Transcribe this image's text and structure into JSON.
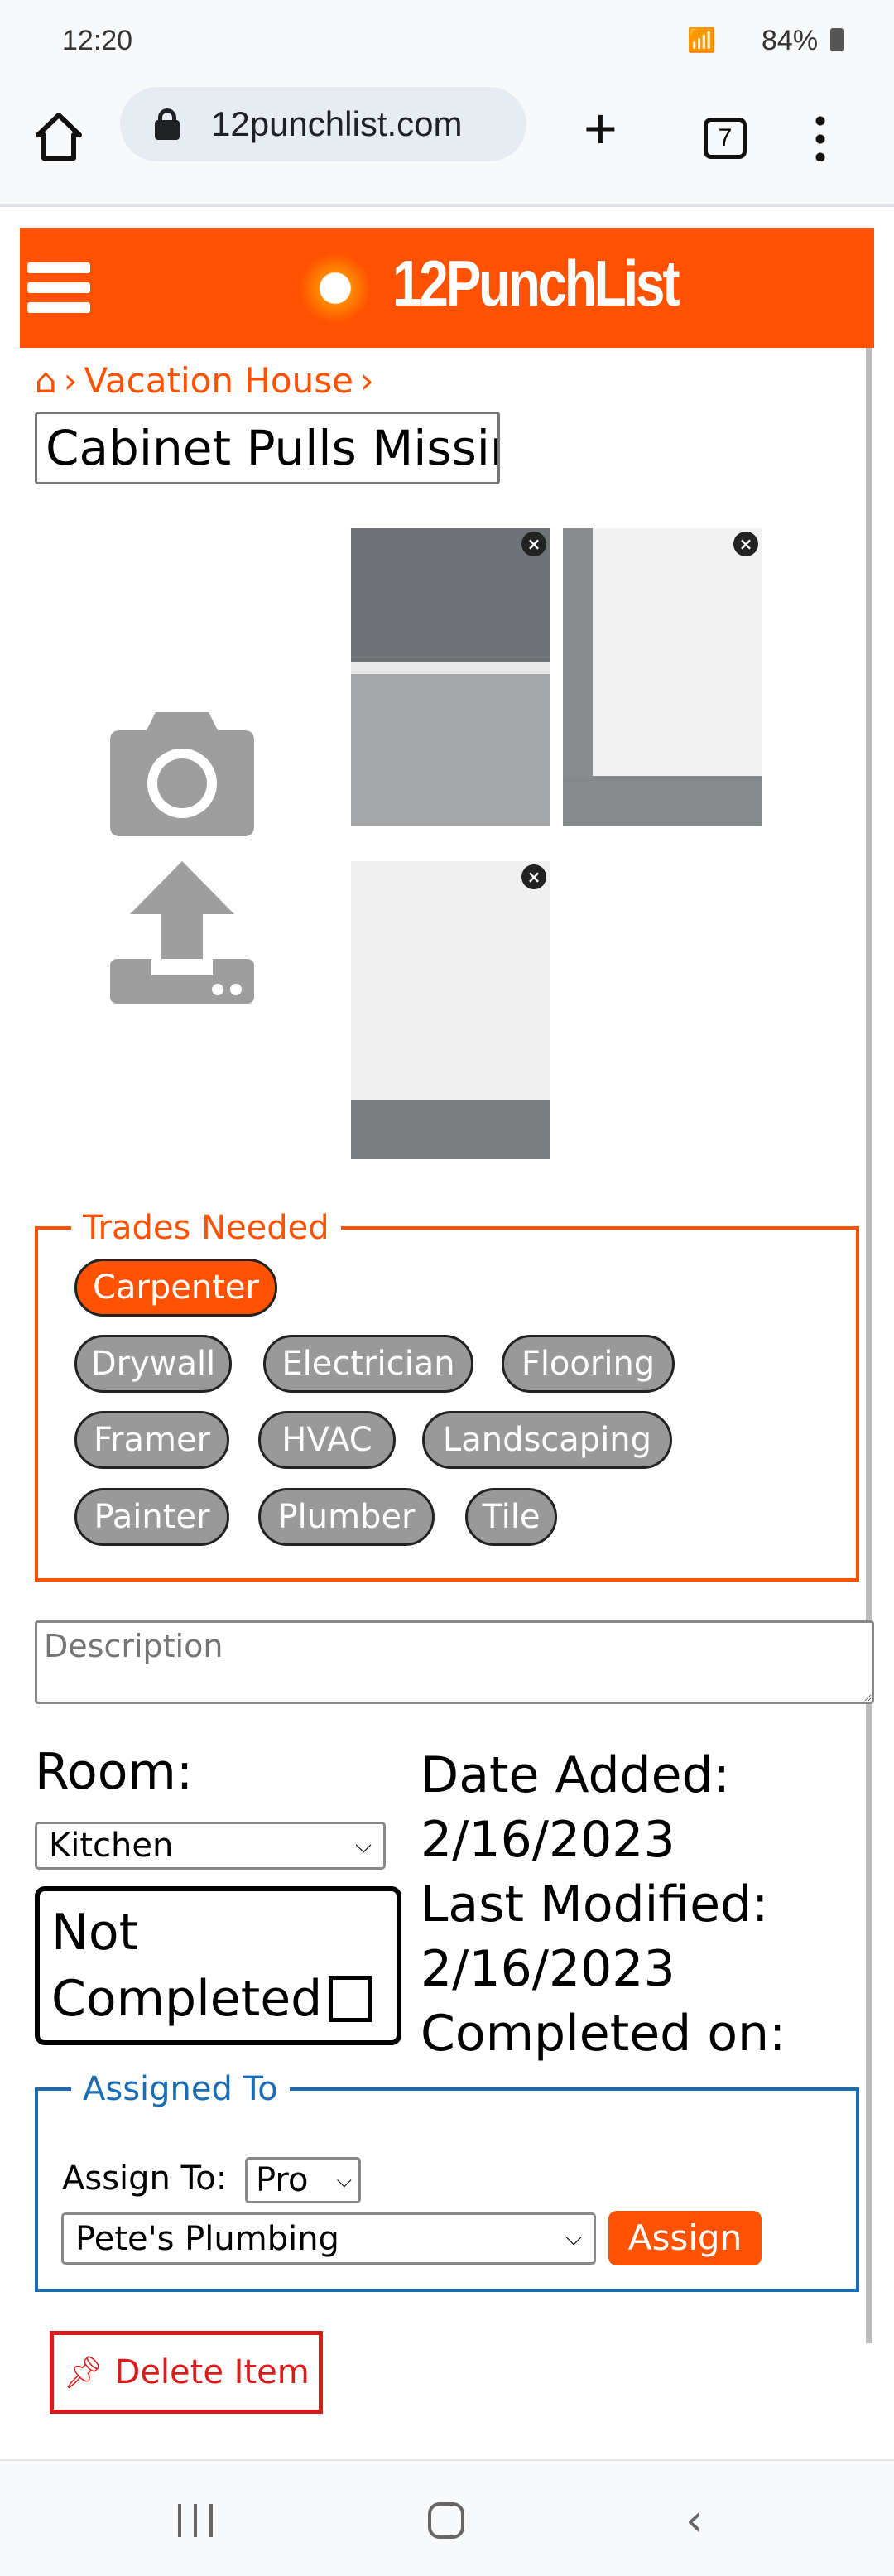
{
  "status_bar": {
    "time": "12:20",
    "battery": "84%"
  },
  "browser": {
    "url": "12punchlist.com",
    "tab_count": "7"
  },
  "header": {
    "brand": "12PunchList"
  },
  "breadcrumb": {
    "items": [
      "Vacation House"
    ]
  },
  "item": {
    "title": "Cabinet Pulls Missing"
  },
  "trades": {
    "legend": "Trades Needed",
    "items": [
      {
        "label": "Carpenter",
        "selected": true
      },
      {
        "label": "Drywall",
        "selected": false
      },
      {
        "label": "Electrician",
        "selected": false
      },
      {
        "label": "Flooring",
        "selected": false
      },
      {
        "label": "Framer",
        "selected": false
      },
      {
        "label": "HVAC",
        "selected": false
      },
      {
        "label": "Landscaping",
        "selected": false
      },
      {
        "label": "Painter",
        "selected": false
      },
      {
        "label": "Plumber",
        "selected": false
      },
      {
        "label": "Tile",
        "selected": false
      }
    ]
  },
  "description": {
    "placeholder": "Description",
    "value": ""
  },
  "room": {
    "label": "Room:",
    "value": "Kitchen"
  },
  "completion": {
    "line1": "Not",
    "line2": "Completed",
    "checked": false
  },
  "dates": {
    "added_label": "Date Added:",
    "added": "2/16/2023",
    "modified_label": "Last Modified:",
    "modified": "2/16/2023",
    "completed_label": "Completed on:"
  },
  "assigned": {
    "legend": "Assigned To",
    "assign_to_label": "Assign To:",
    "type": "Pro",
    "assignee": "Pete's Plumbing",
    "assign_button": "Assign"
  },
  "delete_button": "Delete Item",
  "colors": {
    "brand": "#ff5200",
    "assigned": "#1a6db5",
    "delete": "#d81b1b"
  }
}
